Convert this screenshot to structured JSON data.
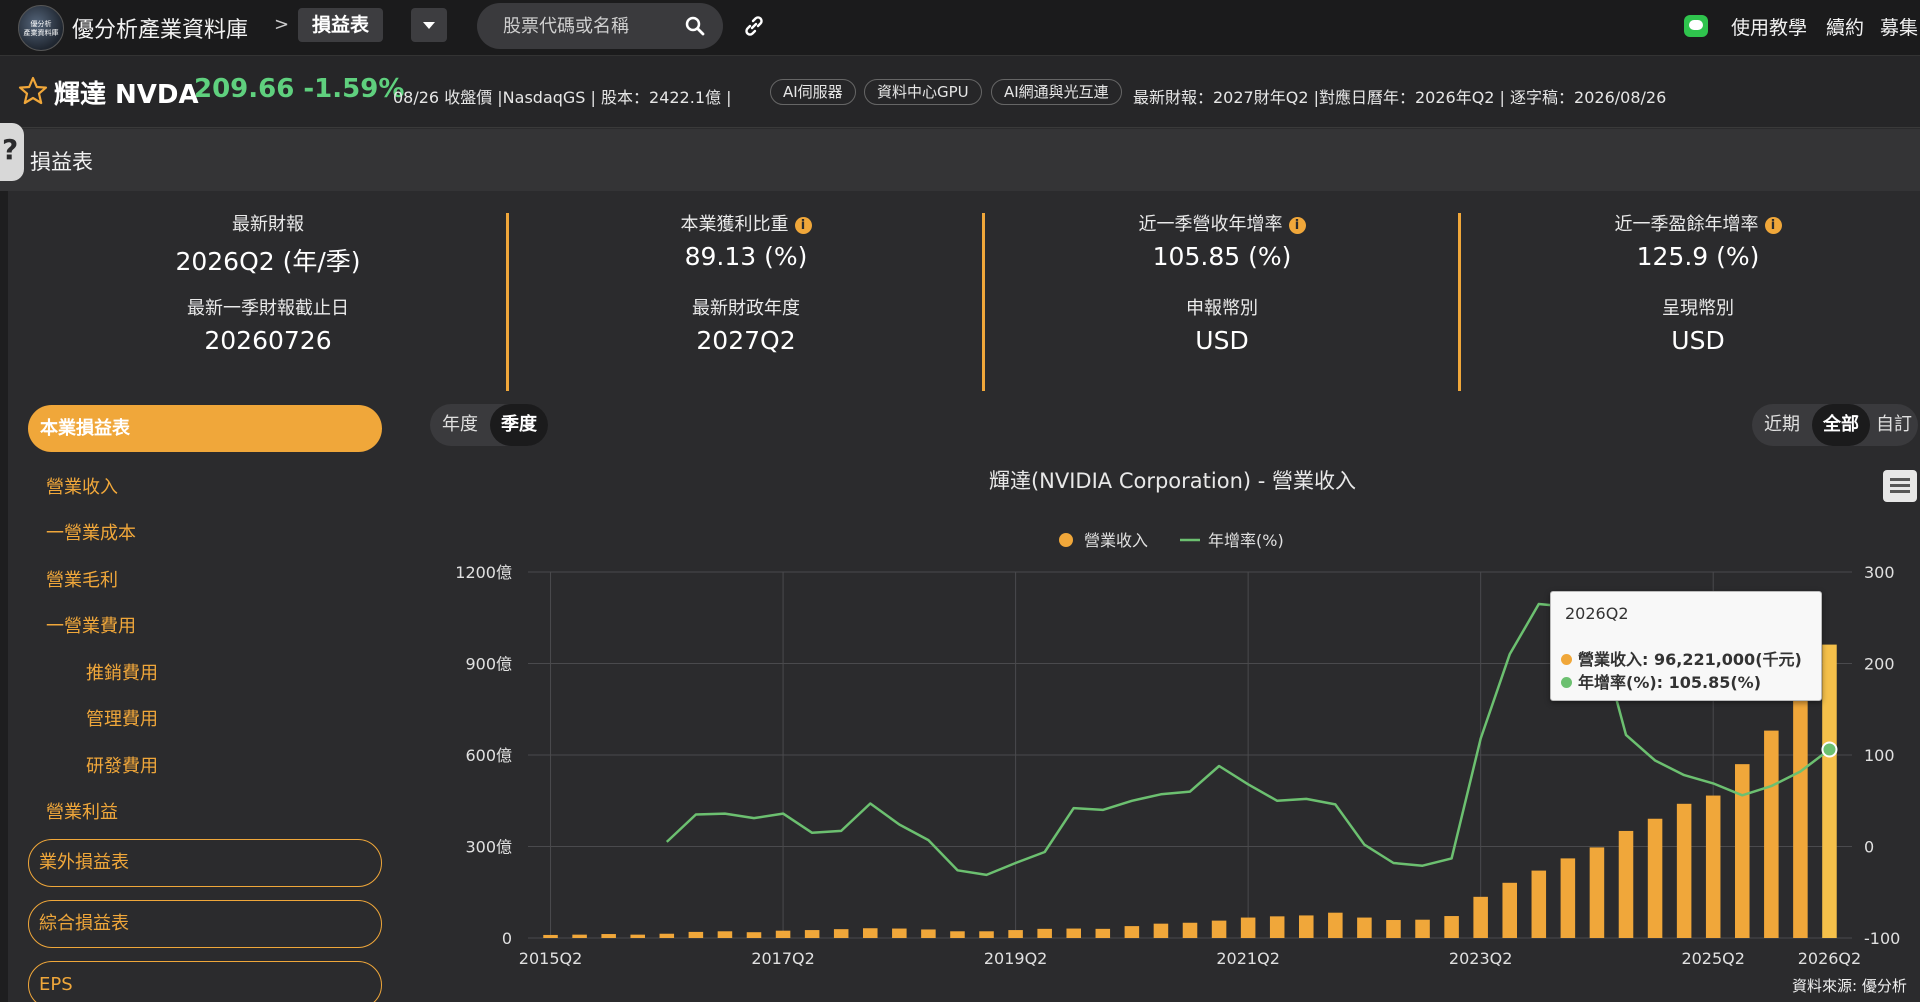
{
  "topbar": {
    "logo_text": "優分析 產業資料庫",
    "app_title": "優分析產業資料庫",
    "crumb_sep": ">",
    "current_page": "損益表",
    "search_placeholder": "股票代碼或名稱",
    "links": [
      "使用教學",
      "續約",
      "募集"
    ]
  },
  "stock": {
    "name": "輝達 NVDA",
    "price_change": "209.66 -1.59%",
    "info1": "08/26 收盤價 |NasdaqGS | 股本：2422.1億 |",
    "tags": [
      "AI伺服器",
      "資料中心GPU",
      "AI網通與光互連"
    ],
    "info2": "最新財報：2027財年Q2 |對應日曆年：2026年Q2 | 逐字稿：2026/08/26",
    "price_color": "#5fd07e"
  },
  "section_title": "損益表",
  "stats": [
    {
      "label": "最新財報",
      "value": "2026Q2 (年/季)",
      "label2": "最新一季財報截止日",
      "value2": "20260726",
      "info": false
    },
    {
      "label": "本業獲利比重",
      "value": "89.13 (%)",
      "label2": "最新財政年度",
      "value2": "2027Q2",
      "info": true
    },
    {
      "label": "近一季營收年增率",
      "value": "105.85 (%)",
      "label2": "申報幣別",
      "value2": "USD",
      "info": true
    },
    {
      "label": "近一季盈餘年增率",
      "value": "125.9 (%)",
      "label2": "呈現幣別",
      "value2": "USD",
      "info": true
    }
  ],
  "sidebar": {
    "main": "本業損益表",
    "items": [
      "營業收入",
      "一營業成本",
      "營業毛利",
      "一營業費用",
      "推銷費用",
      "管理費用",
      "研發費用",
      "營業利益"
    ],
    "outlined": [
      "業外損益表",
      "綜合損益表",
      "EPS"
    ]
  },
  "period_toggle": {
    "year": "年度",
    "quarter": "季度",
    "active": "季度"
  },
  "range_toggle": {
    "recent": "近期",
    "all": "全部",
    "custom": "自訂",
    "active": "全部"
  },
  "chart_title": "輝達(NVIDIA Corporation) - 營業收入",
  "chart_data": {
    "type": "bar",
    "x": [
      "2015Q2",
      "2015Q3",
      "2015Q4",
      "2016Q1",
      "2016Q2",
      "2016Q3",
      "2016Q4",
      "2017Q1",
      "2017Q2",
      "2017Q3",
      "2017Q4",
      "2018Q1",
      "2018Q2",
      "2018Q3",
      "2018Q4",
      "2019Q1",
      "2019Q2",
      "2019Q3",
      "2019Q4",
      "2020Q1",
      "2020Q2",
      "2020Q3",
      "2020Q4",
      "2021Q1",
      "2021Q2",
      "2021Q3",
      "2021Q4",
      "2022Q1",
      "2022Q2",
      "2022Q3",
      "2022Q4",
      "2023Q1",
      "2023Q2",
      "2023Q3",
      "2023Q4",
      "2024Q1",
      "2024Q2",
      "2024Q3",
      "2024Q4",
      "2025Q1",
      "2025Q2",
      "2025Q3",
      "2025Q4",
      "2026Q1",
      "2026Q2"
    ],
    "x_ticks": [
      "2015Q2",
      "2017Q2",
      "2019Q2",
      "2021Q2",
      "2023Q2",
      "2025Q2",
      "2026Q2"
    ],
    "series": [
      {
        "name": "營業收入",
        "axis": "left",
        "color": "#f0a73a",
        "values": [
          10,
          11,
          13,
          11,
          14,
          20,
          22,
          19,
          24,
          26,
          29,
          32,
          31,
          28,
          22,
          22,
          26,
          30,
          31,
          30,
          39,
          47,
          50,
          57,
          67,
          71,
          74,
          83,
          67,
          59,
          60,
          72,
          135,
          181,
          221,
          261,
          297,
          351,
          391,
          440,
          467,
          570,
          680,
          815,
          962
        ]
      },
      {
        "name": "年增率(%)",
        "axis": "right",
        "color": "#6cc070",
        "values": [
          null,
          null,
          null,
          null,
          5,
          35,
          36,
          31,
          36,
          15,
          17,
          47,
          24,
          7,
          -26,
          -31,
          -18,
          -6,
          42,
          40,
          50,
          57,
          60,
          88,
          68,
          50,
          52,
          46,
          2,
          -18,
          -21,
          -13,
          118,
          210,
          265,
          262,
          240,
          122,
          94,
          78,
          69,
          56,
          66,
          82,
          106
        ]
      }
    ],
    "left_ticks": [
      "0",
      "300億",
      "600億",
      "900億",
      "1200億"
    ],
    "right_ticks": [
      "-100",
      "0",
      "100",
      "200",
      "300"
    ],
    "left_range": [
      0,
      1200
    ],
    "right_range": [
      -100,
      300
    ],
    "left_unit": "億",
    "grid": true,
    "legend_position": "top-center"
  },
  "tooltip": {
    "title": "2026Q2",
    "revenue": "營業收入: 96,221,000(千元)",
    "yoy": "年增率(%): 105.85(%)"
  },
  "source": "資料來源: 優分析"
}
